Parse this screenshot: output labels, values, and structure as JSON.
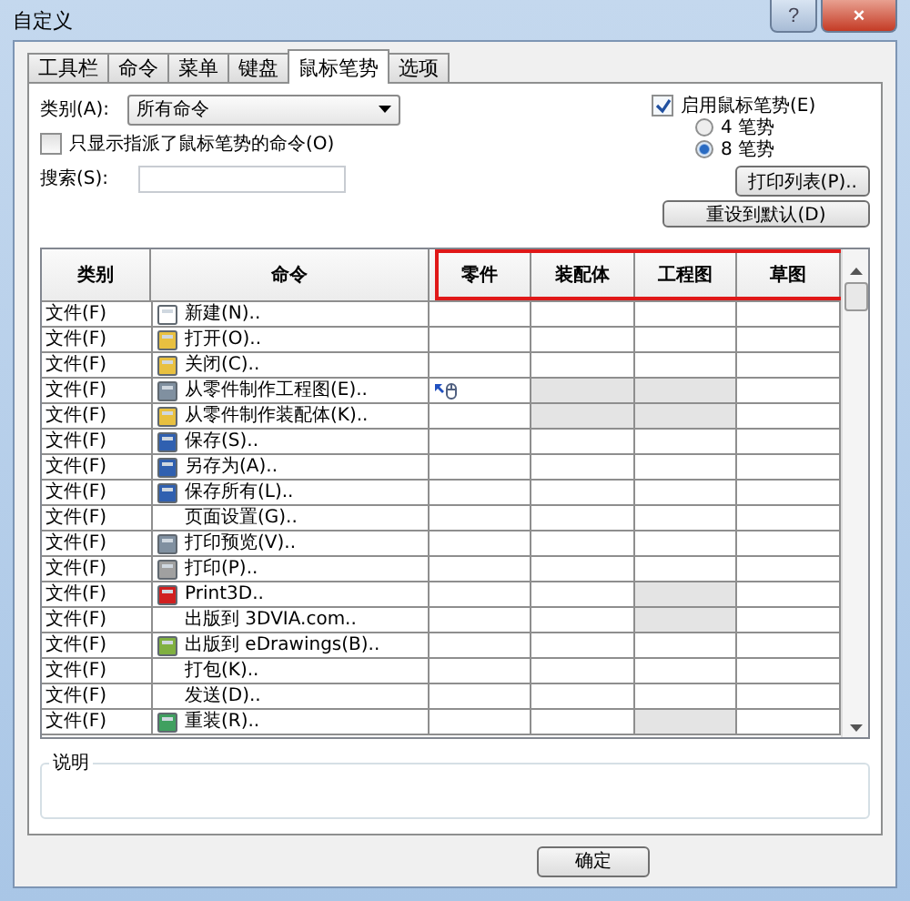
{
  "window": {
    "title": "自定义",
    "help": "?",
    "close": "×"
  },
  "tabs": [
    {
      "label": "工具栏",
      "selected": false
    },
    {
      "label": "命令",
      "selected": false
    },
    {
      "label": "菜单",
      "selected": false
    },
    {
      "label": "键盘",
      "selected": false
    },
    {
      "label": "鼠标笔势",
      "selected": true
    },
    {
      "label": "选项",
      "selected": false
    }
  ],
  "category": {
    "label": "类别(A):",
    "value": "所有命令"
  },
  "only_assigned": {
    "label": "只显示指派了鼠标笔势的命令(O)",
    "checked": false
  },
  "search": {
    "label": "搜索(S):"
  },
  "enable_gestures": {
    "label": "启用鼠标笔势(E)",
    "checked": true
  },
  "gesture_options": [
    {
      "label": "4 笔势",
      "selected": false
    },
    {
      "label": "8 笔势",
      "selected": true
    }
  ],
  "print_button": "打印列表(P)..",
  "reset_button": "重设到默认(D)",
  "table": {
    "columns": [
      {
        "label": "类别",
        "highlighted": false
      },
      {
        "label": "命令",
        "highlighted": false
      },
      {
        "label": "零件",
        "highlighted": true
      },
      {
        "label": "装配体",
        "highlighted": true
      },
      {
        "label": "工程图",
        "highlighted": true
      },
      {
        "label": "草图",
        "highlighted": true
      }
    ],
    "rows": [
      {
        "category": "文件(F)",
        "command": "新建(N)..",
        "has_icon": true,
        "cells": [
          {
            "disabled": false,
            "gesture": false
          },
          {
            "disabled": false,
            "gesture": false
          },
          {
            "disabled": false,
            "gesture": false
          },
          {
            "disabled": false,
            "gesture": false
          }
        ]
      },
      {
        "category": "文件(F)",
        "command": "打开(O)..",
        "has_icon": true,
        "cells": [
          {
            "disabled": false,
            "gesture": false
          },
          {
            "disabled": false,
            "gesture": false
          },
          {
            "disabled": false,
            "gesture": false
          },
          {
            "disabled": false,
            "gesture": false
          }
        ]
      },
      {
        "category": "文件(F)",
        "command": "关闭(C)..",
        "has_icon": true,
        "cells": [
          {
            "disabled": false,
            "gesture": false
          },
          {
            "disabled": false,
            "gesture": false
          },
          {
            "disabled": false,
            "gesture": false
          },
          {
            "disabled": false,
            "gesture": false
          }
        ]
      },
      {
        "category": "文件(F)",
        "command": "从零件制作工程图(E)..",
        "has_icon": true,
        "cells": [
          {
            "disabled": false,
            "gesture": true
          },
          {
            "disabled": true,
            "gesture": false
          },
          {
            "disabled": true,
            "gesture": false
          },
          {
            "disabled": false,
            "gesture": false
          }
        ]
      },
      {
        "category": "文件(F)",
        "command": "从零件制作装配体(K)..",
        "has_icon": true,
        "cells": [
          {
            "disabled": false,
            "gesture": false
          },
          {
            "disabled": true,
            "gesture": false
          },
          {
            "disabled": true,
            "gesture": false
          },
          {
            "disabled": false,
            "gesture": false
          }
        ]
      },
      {
        "category": "文件(F)",
        "command": "保存(S)..",
        "has_icon": true,
        "cells": [
          {
            "disabled": false,
            "gesture": false
          },
          {
            "disabled": false,
            "gesture": false
          },
          {
            "disabled": false,
            "gesture": false
          },
          {
            "disabled": false,
            "gesture": false
          }
        ]
      },
      {
        "category": "文件(F)",
        "command": "另存为(A)..",
        "has_icon": true,
        "cells": [
          {
            "disabled": false,
            "gesture": false
          },
          {
            "disabled": false,
            "gesture": false
          },
          {
            "disabled": false,
            "gesture": false
          },
          {
            "disabled": false,
            "gesture": false
          }
        ]
      },
      {
        "category": "文件(F)",
        "command": "保存所有(L)..",
        "has_icon": true,
        "cells": [
          {
            "disabled": false,
            "gesture": false
          },
          {
            "disabled": false,
            "gesture": false
          },
          {
            "disabled": false,
            "gesture": false
          },
          {
            "disabled": false,
            "gesture": false
          }
        ]
      },
      {
        "category": "文件(F)",
        "command": "页面设置(G)..",
        "has_icon": false,
        "cells": [
          {
            "disabled": false,
            "gesture": false
          },
          {
            "disabled": false,
            "gesture": false
          },
          {
            "disabled": false,
            "gesture": false
          },
          {
            "disabled": false,
            "gesture": false
          }
        ]
      },
      {
        "category": "文件(F)",
        "command": "打印预览(V)..",
        "has_icon": true,
        "cells": [
          {
            "disabled": false,
            "gesture": false
          },
          {
            "disabled": false,
            "gesture": false
          },
          {
            "disabled": false,
            "gesture": false
          },
          {
            "disabled": false,
            "gesture": false
          }
        ]
      },
      {
        "category": "文件(F)",
        "command": "打印(P)..",
        "has_icon": true,
        "cells": [
          {
            "disabled": false,
            "gesture": false
          },
          {
            "disabled": false,
            "gesture": false
          },
          {
            "disabled": false,
            "gesture": false
          },
          {
            "disabled": false,
            "gesture": false
          }
        ]
      },
      {
        "category": "文件(F)",
        "command": "Print3D..",
        "has_icon": true,
        "cells": [
          {
            "disabled": false,
            "gesture": false
          },
          {
            "disabled": false,
            "gesture": false
          },
          {
            "disabled": true,
            "gesture": false
          },
          {
            "disabled": false,
            "gesture": false
          }
        ]
      },
      {
        "category": "文件(F)",
        "command": "出版到 3DVIA.com..",
        "has_icon": false,
        "cells": [
          {
            "disabled": false,
            "gesture": false
          },
          {
            "disabled": false,
            "gesture": false
          },
          {
            "disabled": true,
            "gesture": false
          },
          {
            "disabled": false,
            "gesture": false
          }
        ]
      },
      {
        "category": "文件(F)",
        "command": "出版到 eDrawings(B)..",
        "has_icon": true,
        "cells": [
          {
            "disabled": false,
            "gesture": false
          },
          {
            "disabled": false,
            "gesture": false
          },
          {
            "disabled": false,
            "gesture": false
          },
          {
            "disabled": false,
            "gesture": false
          }
        ]
      },
      {
        "category": "文件(F)",
        "command": "打包(K)..",
        "has_icon": false,
        "cells": [
          {
            "disabled": false,
            "gesture": false
          },
          {
            "disabled": false,
            "gesture": false
          },
          {
            "disabled": false,
            "gesture": false
          },
          {
            "disabled": false,
            "gesture": false
          }
        ]
      },
      {
        "category": "文件(F)",
        "command": "发送(D)..",
        "has_icon": false,
        "cells": [
          {
            "disabled": false,
            "gesture": false
          },
          {
            "disabled": false,
            "gesture": false
          },
          {
            "disabled": false,
            "gesture": false
          },
          {
            "disabled": false,
            "gesture": false
          }
        ]
      },
      {
        "category": "文件(F)",
        "command": "重装(R)..",
        "has_icon": true,
        "cells": [
          {
            "disabled": false,
            "gesture": false
          },
          {
            "disabled": false,
            "gesture": false
          },
          {
            "disabled": true,
            "gesture": false
          },
          {
            "disabled": false,
            "gesture": false
          }
        ]
      }
    ]
  },
  "description": {
    "label": "说明"
  },
  "ok_button": "确定"
}
